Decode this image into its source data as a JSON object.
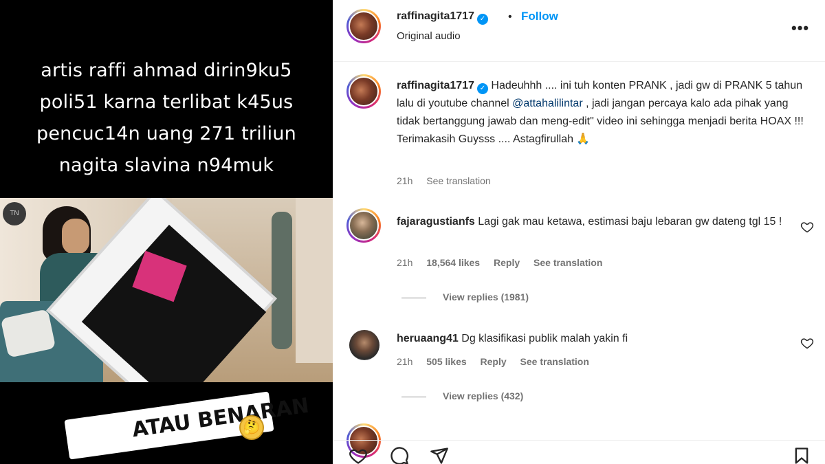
{
  "media": {
    "caption_lines": [
      "artis raffi ahmad dirin9ku5",
      "poli51 karna terlibat k45us",
      "pencuc14n uang 271 triliun",
      "nagita slavina n94muk"
    ],
    "stamp_text": "ATAU BENARAN",
    "stamp_emoji": "🤔",
    "watermark_logo": "TN"
  },
  "post": {
    "username": "raffinagita1717",
    "verified": true,
    "separator": "•",
    "follow_label": "Follow",
    "audio_label": "Original audio",
    "more_icon": "more-horizontal-icon"
  },
  "caption_comment": {
    "username": "raffinagita1717",
    "text_before_mention": "Hadeuhhh .... ini tuh konten PRANK , jadi gw di PRANK 5 tahun lalu di youtube channel",
    "mention": "@attahalilintar",
    "text_after_mention": ", jadi jangan percaya kalo ada pihak yang tidak bertanggung jawab dan meng-edit\" video ini sehingga menjadi berita HOAX !!! Terimakasih Guysss .... Astagfirullah 🙏",
    "time": "21h",
    "see_translation": "See translation"
  },
  "comments": [
    {
      "username": "fajaragustianfs",
      "text": "Lagi gak mau ketawa, estimasi baju lebaran gw dateng tgl 15 !",
      "time": "21h",
      "likes": "18,564 likes",
      "reply": "Reply",
      "see_translation": "See translation",
      "view_replies": "View replies (1981)"
    },
    {
      "username": "heruaang41",
      "text": "Dg klasifikasi publik malah yakin fi",
      "time": "21h",
      "likes": "505 likes",
      "reply": "Reply",
      "see_translation": "See translation",
      "view_replies": "View replies (432)"
    }
  ],
  "actions": {
    "like_icon": "heart-icon",
    "comment_icon": "comment-icon",
    "share_icon": "share-icon",
    "save_icon": "bookmark-icon"
  },
  "colors": {
    "accent": "#0095f6",
    "mention": "#00376b",
    "muted": "#737373",
    "text": "#262626"
  }
}
